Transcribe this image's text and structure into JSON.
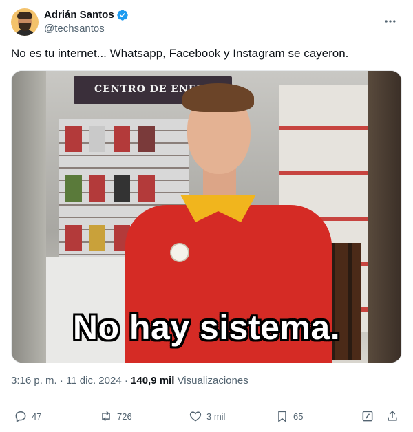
{
  "author": {
    "name": "Adrián Santos",
    "handle": "@techsantos",
    "verified": true
  },
  "tweet": {
    "text": "No es tu internet... Whatsapp, Facebook y Instagram se cayeron.",
    "media_caption": "No hay sistema.",
    "store_sign": "CENTRO DE ENERGIA"
  },
  "meta": {
    "time": "3:16 p. m.",
    "separator": "·",
    "date": "11 dic. 2024",
    "views_count": "140,9 mil",
    "views_label": "Visualizaciones"
  },
  "actions": {
    "replies": "47",
    "retweets": "726",
    "likes": "3 mil",
    "bookmarks": "65"
  },
  "colors": {
    "text": "#0f1419",
    "secondary": "#536471",
    "verified": "#1d9bf0"
  }
}
